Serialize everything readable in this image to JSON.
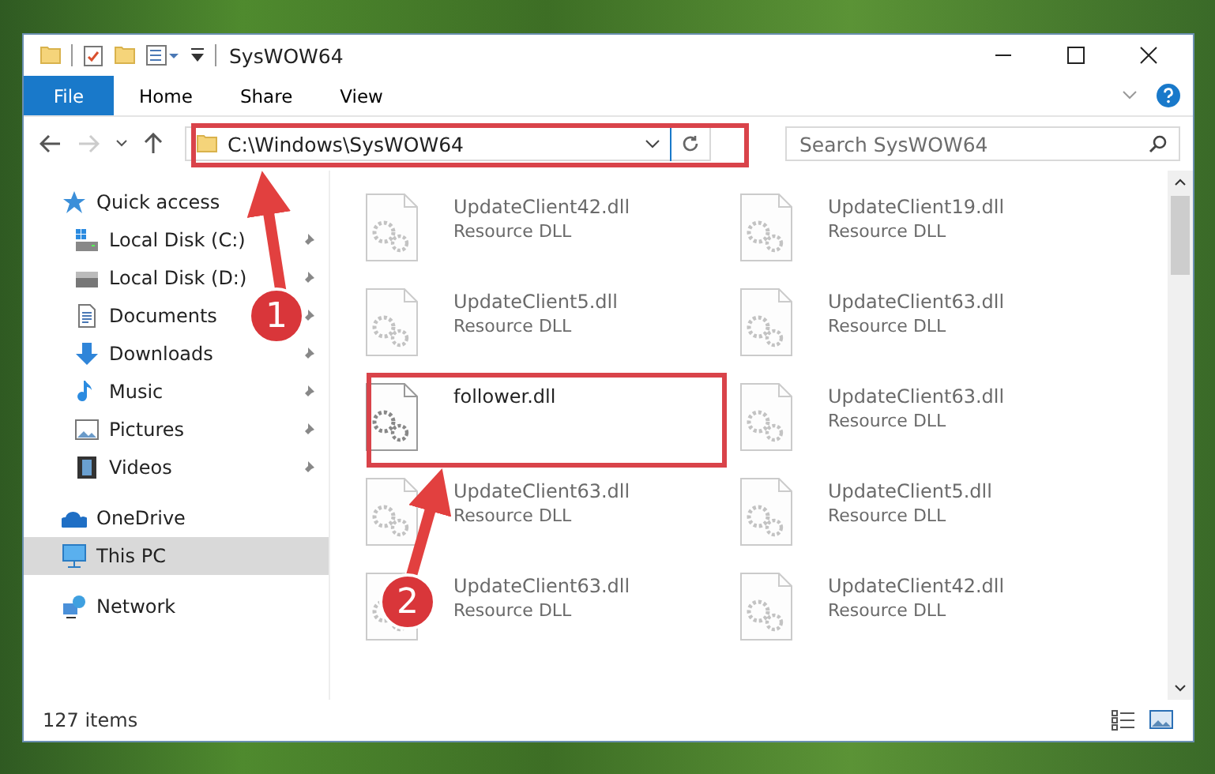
{
  "window": {
    "title": "SysWOW64"
  },
  "ribbon": {
    "tabs": [
      {
        "label": "File",
        "kind": "file"
      },
      {
        "label": "Home",
        "kind": "tab"
      },
      {
        "label": "Share",
        "kind": "tab"
      },
      {
        "label": "View",
        "kind": "tab"
      }
    ]
  },
  "address": {
    "path": "C:\\Windows\\SysWOW64"
  },
  "search": {
    "placeholder": "Search SysWOW64"
  },
  "navigation": [
    {
      "label": "Quick access",
      "selected": false,
      "children": [
        {
          "label": "Local Disk (C:)",
          "pinned": true,
          "selected": false
        },
        {
          "label": "Local Disk (D:)",
          "pinned": true,
          "selected": false
        },
        {
          "label": "Documents",
          "pinned": true,
          "selected": false
        },
        {
          "label": "Downloads",
          "pinned": true,
          "selected": false
        },
        {
          "label": "Music",
          "pinned": true,
          "selected": false
        },
        {
          "label": "Pictures",
          "pinned": true,
          "selected": false
        },
        {
          "label": "Videos",
          "pinned": true,
          "selected": false
        }
      ]
    },
    {
      "label": "OneDrive",
      "selected": false
    },
    {
      "label": "This PC",
      "selected": true
    },
    {
      "label": "Network",
      "selected": false
    }
  ],
  "files": [
    {
      "name": "UpdateClient42.dll",
      "type": "Resource DLL",
      "blurred": true
    },
    {
      "name": "UpdateClient19.dll",
      "type": "Resource DLL",
      "blurred": true
    },
    {
      "name": "UpdateClient5.dll",
      "type": "Resource DLL",
      "blurred": true
    },
    {
      "name": "UpdateClient63.dll",
      "type": "Resource DLL",
      "blurred": true
    },
    {
      "name": "follower.dll",
      "blurred": false
    },
    {
      "name": "UpdateClient63.dll",
      "type": "Resource DLL",
      "blurred": true
    },
    {
      "name": "UpdateClient63.dll",
      "type": "Resource DLL",
      "blurred": true
    },
    {
      "name": "UpdateClient5.dll",
      "type": "Resource DLL",
      "blurred": true
    },
    {
      "name": "UpdateClient63.dll",
      "type": "Resource DLL",
      "blurred": true
    },
    {
      "name": "UpdateClient42.dll",
      "type": "Resource DLL",
      "blurred": true
    }
  ],
  "status_bar": {
    "count": "127 items"
  },
  "annotations": [
    {
      "number": "1"
    },
    {
      "number": "2"
    }
  ]
}
